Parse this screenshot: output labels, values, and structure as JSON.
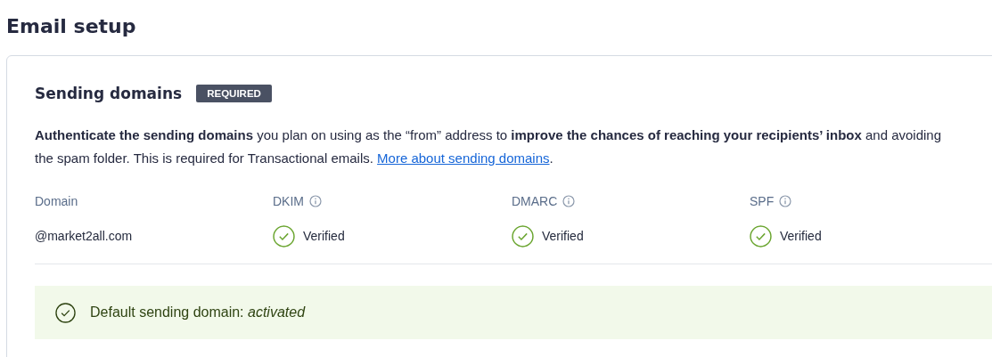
{
  "page_title": "Email setup",
  "section": {
    "title": "Sending domains",
    "badge": "REQUIRED",
    "description": {
      "text": "**Authenticate the sending domains** you plan on using as the “from” address to **improve the chances of reaching your recipients’ inbox** and avoiding the spam folder. This is required for Transactional emails. ",
      "link": "More about sending domains",
      "after": "."
    },
    "table": {
      "columns": [
        {
          "label": "Domain",
          "info": false
        },
        {
          "label": "DKIM",
          "info": true
        },
        {
          "label": "DMARC",
          "info": true
        },
        {
          "label": "SPF",
          "info": true
        }
      ],
      "rows": [
        {
          "domain": "@market2all.com",
          "checks": [
            {
              "kind": "verified",
              "label": "Verified"
            },
            {
              "kind": "verified",
              "label": "Verified"
            },
            {
              "kind": "verified",
              "label": "Verified"
            }
          ]
        }
      ]
    },
    "banner": {
      "kind": "success",
      "text": "Default sending domain: *activated*"
    }
  }
}
